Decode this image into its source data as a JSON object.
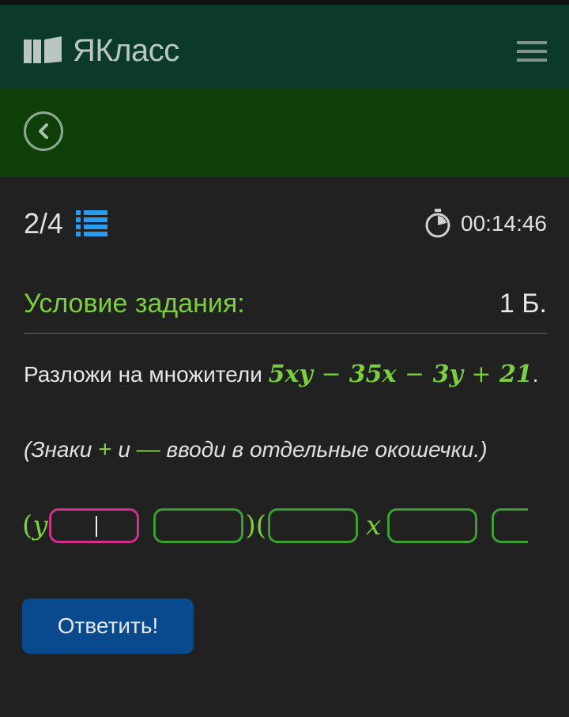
{
  "header": {
    "logo_text": "ЯКласс",
    "colors": {
      "topbar": "#0b3a2a",
      "subbar": "#0f3f08"
    }
  },
  "nav": {
    "back_icon": "chevron-left-icon"
  },
  "progress": {
    "current_of_total": "2/4"
  },
  "timer": {
    "value": "00:14:46"
  },
  "task": {
    "condition_title": "Условие задания:",
    "points": "1 Б.",
    "prompt": "Разложи на множители",
    "expression": {
      "t1": "5xy",
      "op1": "−",
      "t2": "35x",
      "op2": "−",
      "t3": "3y",
      "op3": "+",
      "t4": "21",
      "end": "."
    },
    "hint": {
      "open": "(Знаки",
      "plus": "+",
      "and": "и",
      "minus": "—",
      "rest": "вводи в отдельные окошечки.)"
    },
    "answer_template": {
      "lp1": "(",
      "var1": "y",
      "rp_lp": ")(",
      "var2": "x"
    }
  },
  "actions": {
    "submit_label": "Ответить!"
  },
  "colors": {
    "accent_green": "#7bcf3c",
    "input_border": "#3aa02e",
    "input_active": "#d0308c",
    "button": "#094a8f",
    "background": "#212121"
  }
}
